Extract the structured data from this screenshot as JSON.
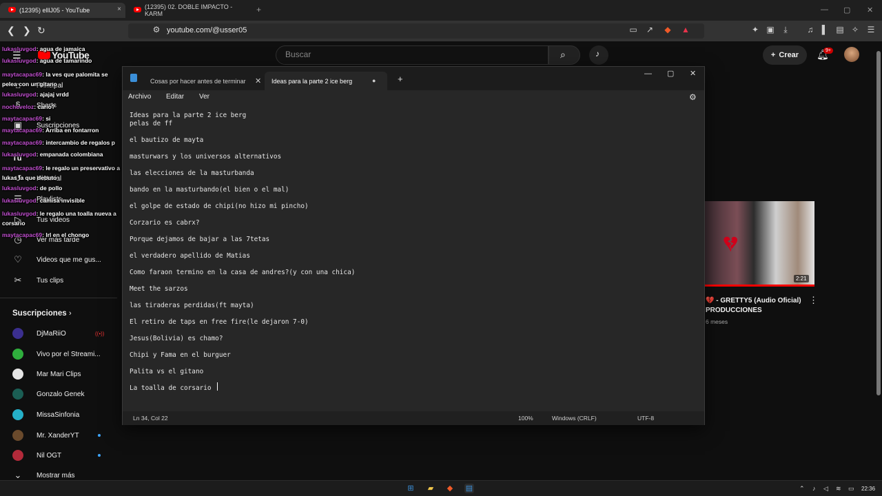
{
  "browser": {
    "tabs": [
      {
        "title": "(12395) elllJ05 - YouTube",
        "close": "×"
      },
      {
        "title": "(12395) 02. DOBLE IMPACTO - KARM",
        "close": "×"
      }
    ],
    "new_tab": "+",
    "window_controls": {
      "min": "—",
      "max": "▢",
      "close": "✕"
    },
    "address": "youtube.com/@usser05",
    "nav": {
      "back": "❮",
      "forward": "❯",
      "reload": "↻"
    }
  },
  "youtube": {
    "logo_text": "YouTube",
    "search_placeholder": "Buscar",
    "create_label": "Crear",
    "notification_count": "9+",
    "sidebar": [
      {
        "label": "Principal",
        "icon": "⌂"
      },
      {
        "label": "Shorts",
        "icon": "§"
      },
      {
        "label": "Suscripciones",
        "icon": "▣"
      },
      {
        "label": "Tú",
        "icon": ""
      },
      {
        "label": "Historial",
        "icon": "↺"
      },
      {
        "label": "Playlists",
        "icon": "☰"
      },
      {
        "label": "Tus videos",
        "icon": "▷"
      },
      {
        "label": "Ver más tarde",
        "icon": "◷"
      },
      {
        "label": "Videos que me gus...",
        "icon": "♡"
      },
      {
        "label": "Tus clips",
        "icon": "✂"
      }
    ],
    "subs_header": "Suscripciones",
    "subscriptions": [
      {
        "name": "DjMaRiiO",
        "color": "#3b2f8f"
      },
      {
        "name": "Vivo por el Streami...",
        "color": "#2fae3d"
      },
      {
        "name": "Mar Mari Clips",
        "color": "#e6e6e6"
      },
      {
        "name": "Gonzalo Genek",
        "color": "#1b5e54"
      },
      {
        "name": "MissaSinfonia",
        "color": "#25b0c8"
      },
      {
        "name": "Mr. XanderYT",
        "color": "#6a4a2c"
      },
      {
        "name": "Nil OGT",
        "color": "#b22a3a"
      }
    ],
    "show_more": "Mostrar más",
    "video": {
      "duration": "2:21",
      "title": "💔 - GRETTY5 (Audio Oficial) PRODUCCIONES",
      "meta": "6 meses"
    }
  },
  "chat": [
    {
      "user": "lukasluvgod",
      "msg": ": agua de jamaica"
    },
    {
      "user": "lukasluvgod",
      "msg": ": agua de tamarindo"
    },
    {
      "user": "maytacapac69",
      "msg": ": la ves que palomita se pelea con un gitano"
    },
    {
      "user": "lukasluvgod",
      "msg": ": ajajaj vrdd"
    },
    {
      "user": "nocheveloz",
      "msg": ": cario?"
    },
    {
      "user": "maytacapac69",
      "msg": ": si"
    },
    {
      "user": "maytacapac69",
      "msg": ": Arriba en fontarron"
    },
    {
      "user": "maytacapac69",
      "msg": ": intercambio de regalos p"
    },
    {
      "user": "lukasluvgod",
      "msg": ": empanada colombiana"
    },
    {
      "user": "maytacapac69",
      "msg": ": le regalo un preservativo a lukas la que debuto"
    },
    {
      "user": "lukasluvgod",
      "msg": ": de pollo"
    },
    {
      "user": "lukasluvgod",
      "msg": ": camisa invisible"
    },
    {
      "user": "lukasluvgod",
      "msg": ": le regalo una toalla nueva a corsario"
    },
    {
      "user": "maytacapac69",
      "msg": ": lrl en el chongo"
    }
  ],
  "notepad": {
    "tab1": "Cosas por hacer antes de terminar e",
    "tab2": "Ideas para la parte 2 ice berg",
    "menu": [
      "Archivo",
      "Editar",
      "Ver"
    ],
    "lines": [
      "Ideas para la parte 2 ice berg",
      "pelas de ff",
      "el bautizo de mayta",
      "masturwars y los universos alternativos",
      "las elecciones de la masturbanda",
      "bando en la masturbando(el bien o el mal)",
      "el golpe de estado de chipi(no hizo mi pincho)",
      "Corzario es cabrx?",
      "Porque dejamos de bajar a las 7tetas",
      "el verdadero apellido de Matias",
      "Como faraon termino en la casa de andres?(y con una chica)",
      "Meet the sarzos",
      "las tiraderas perdidas(ft mayta)",
      "El retiro de taps en free fire(le dejaron 7-0)",
      "Jesus(Bolivia) es chamo?",
      "Chipi y Fama en el burguer",
      "Palita vs el gitano",
      "La toalla de corsario"
    ],
    "status": {
      "pos": "Ln 34, Col 22",
      "zoom": "100%",
      "eol": "Windows (CRLF)",
      "enc": "UTF-8"
    }
  },
  "taskbar": {
    "time": "22:36"
  }
}
